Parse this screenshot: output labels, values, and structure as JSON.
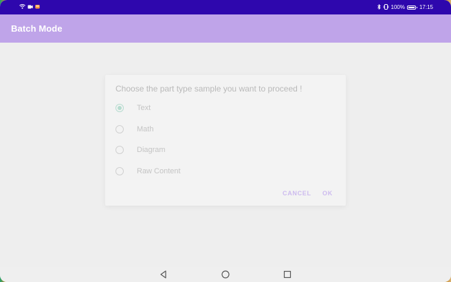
{
  "status_bar": {
    "battery_percent_text": "100%",
    "battery_level": 1.0,
    "time": "17:15",
    "left_icons": [
      "wifi-icon",
      "screen-record-icon",
      "notification-icon"
    ],
    "right_icons": [
      "bluetooth-icon",
      "vibrate-icon",
      "battery-icon"
    ]
  },
  "app_bar": {
    "title": "Batch Mode"
  },
  "dialog": {
    "title": "Choose the part type sample you want to proceed !",
    "options": [
      {
        "label": "Text",
        "selected": true
      },
      {
        "label": "Math",
        "selected": false
      },
      {
        "label": "Diagram",
        "selected": false
      },
      {
        "label": "Raw Content",
        "selected": false
      }
    ],
    "cancel_label": "CANCEL",
    "ok_label": "OK"
  },
  "nav_bar": {
    "icons": [
      "back-icon",
      "home-icon",
      "recents-icon"
    ]
  },
  "colors": {
    "status_bar": "#2e07ad",
    "app_bar": "#bfa4e9",
    "accent_radio": "#b6dccf",
    "button_text": "#cdbbef"
  }
}
